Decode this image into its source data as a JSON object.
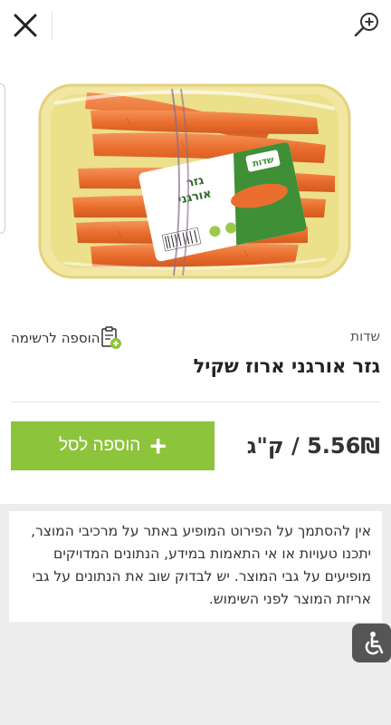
{
  "header": {
    "close_icon": "close-icon",
    "zoom_icon": "zoom-in-icon"
  },
  "product": {
    "brand": "שדות",
    "title": "גזר אורגני ארוז שקיל",
    "price": "5.56₪ / ק\"ג",
    "image": {
      "description_icon": "product-photo",
      "label_text_line1": "גזר",
      "label_text_line2": "אורגני",
      "label_brand": "שדות"
    }
  },
  "actions": {
    "add_to_list_label": "הוספה לרשימה",
    "add_to_list_icon": "clipboard-plus-icon",
    "add_to_cart_label": "הוספה לסל",
    "add_to_cart_icon": "plus-icon"
  },
  "disclaimer": {
    "text": "אין להסתמך על הפירוט המופיע באתר על מרכיבי המוצר, יתכנו טעויות או אי התאמות במידע, הנתונים המדויקים מופיעים על גבי המוצר. יש לבדוק שוב את הנתונים על גבי אריזת המוצר לפני השימוש."
  },
  "accessibility": {
    "icon": "wheelchair-icon"
  },
  "colors": {
    "accent_green": "#8cc43c",
    "background_gray": "#ededed"
  }
}
